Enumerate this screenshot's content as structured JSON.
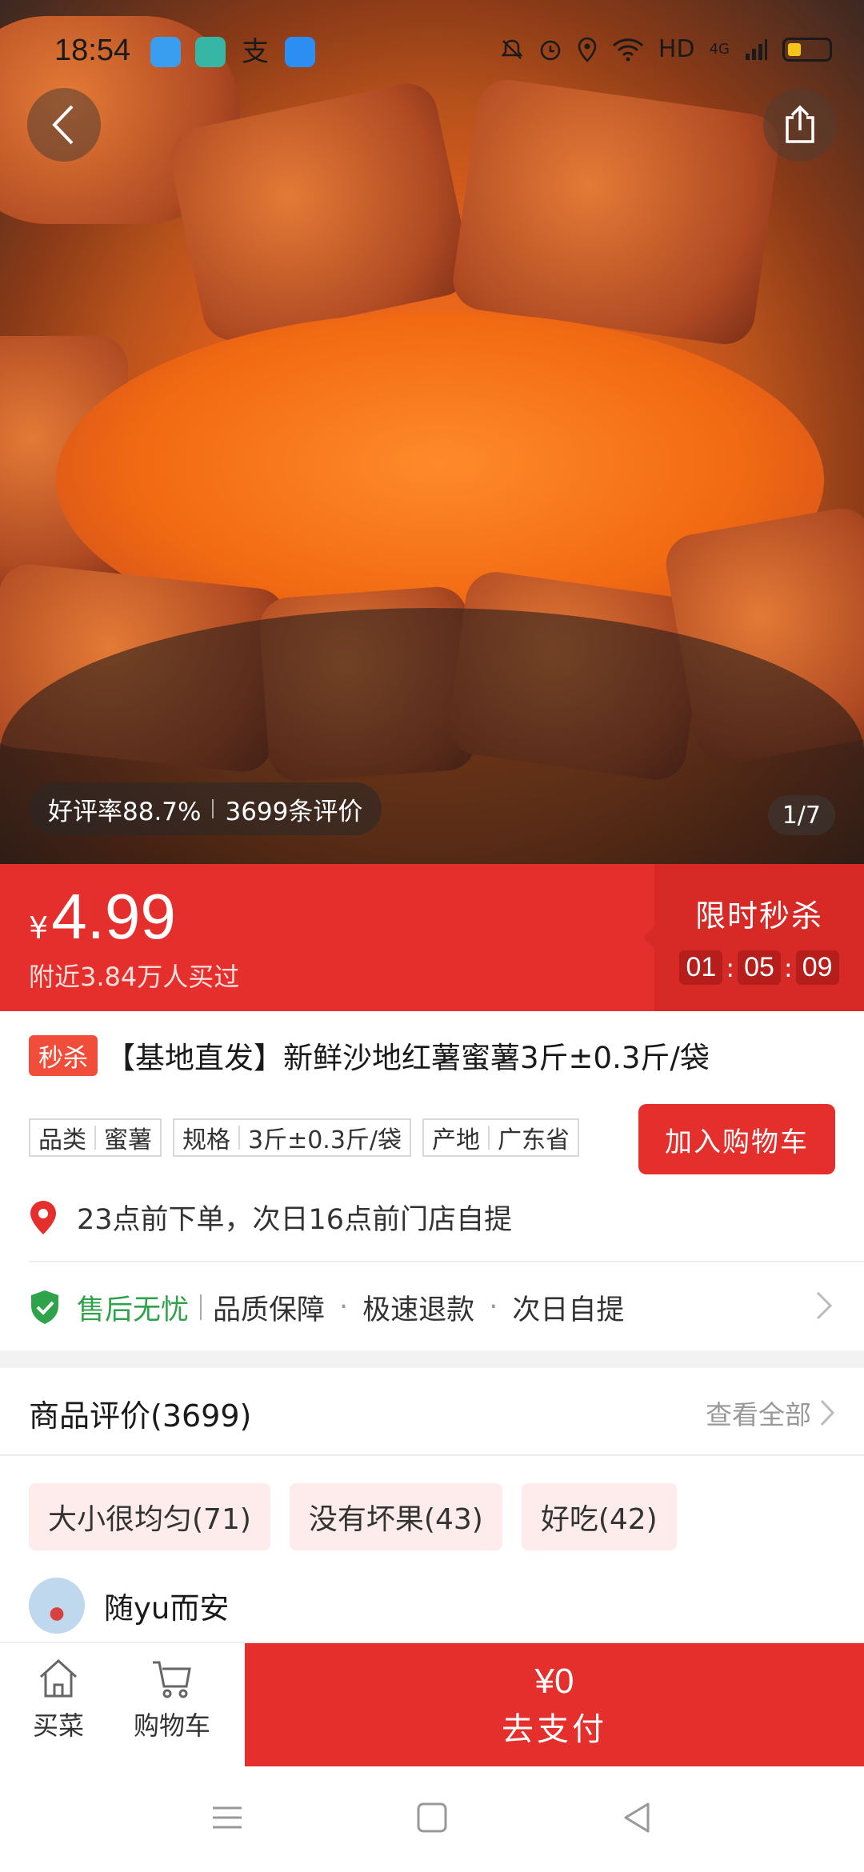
{
  "status_bar": {
    "time": "18:54",
    "network": "HD",
    "cell": "4G"
  },
  "hero": {
    "rating_text": "好评率88.7%",
    "review_count_text": "3699条评价",
    "page_indicator": "1/7"
  },
  "price": {
    "currency": "¥",
    "amount": "4.99",
    "bought_text": "附近3.84万人买过"
  },
  "flash_sale": {
    "title": "限时秒杀",
    "hours": "01",
    "minutes": "05",
    "seconds": "09"
  },
  "product": {
    "badge": "秒杀",
    "title": "【基地直发】新鲜沙地红薯蜜薯3斤±0.3斤/袋",
    "attributes": [
      {
        "key": "品类",
        "value": "蜜薯"
      },
      {
        "key": "规格",
        "value": "3斤±0.3斤/袋"
      },
      {
        "key": "产地",
        "value": "广东省"
      }
    ],
    "add_to_cart": "加入购物车",
    "pickup_text": "23点前下单，次日16点前门店自提"
  },
  "service": {
    "main": "售后无忧",
    "items": [
      "品质保障",
      "极速退款",
      "次日自提"
    ]
  },
  "reviews": {
    "heading": "商品评价(3699)",
    "see_all": "查看全部",
    "tags": [
      "大小很均匀(71)",
      "没有坏果(43)",
      "好吃(42)"
    ],
    "first_reviewer": "随yu而安"
  },
  "bottom_bar": {
    "tab_home": "买菜",
    "tab_cart": "购物车",
    "pay_amount": "¥0",
    "pay_label": "去支付"
  },
  "colors": {
    "brand_red": "#e52f2c",
    "success_green": "#2fa34a"
  }
}
